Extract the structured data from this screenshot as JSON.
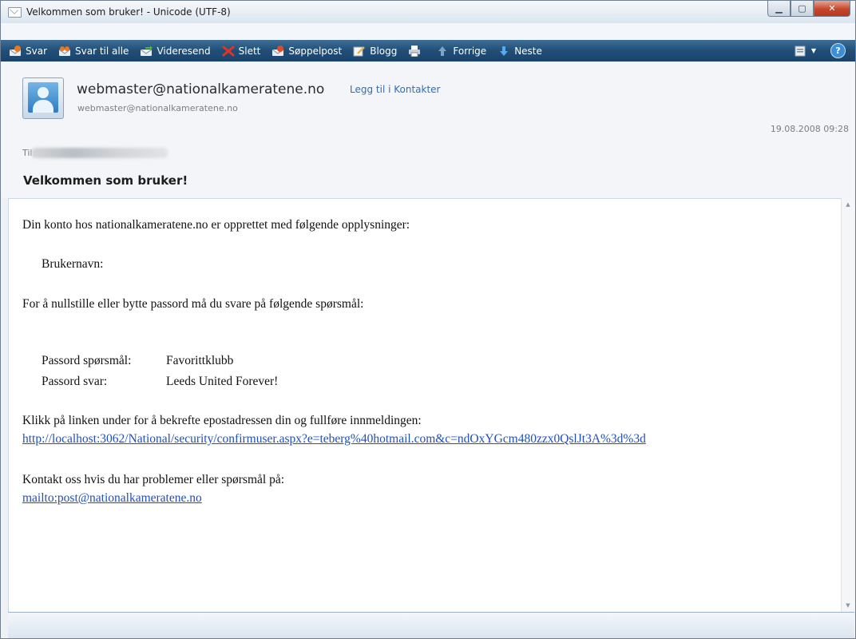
{
  "window": {
    "title": "Velkommen som bruker! - Unicode (UTF-8)"
  },
  "toolbar": {
    "items": [
      {
        "label": "Svar",
        "icon": "reply-icon"
      },
      {
        "label": "Svar til alle",
        "icon": "reply-all-icon"
      },
      {
        "label": "Videresend",
        "icon": "forward-icon"
      },
      {
        "label": "Slett",
        "icon": "delete-icon"
      },
      {
        "label": "Søppelpost",
        "icon": "junk-icon"
      },
      {
        "label": "Blogg",
        "icon": "blog-icon"
      },
      {
        "label": "",
        "icon": "print-icon"
      },
      {
        "label": "Forrige",
        "icon": "previous-arrow-icon"
      },
      {
        "label": "Neste",
        "icon": "next-arrow-icon"
      }
    ]
  },
  "header": {
    "from_name": "webmaster@nationalkameratene.no",
    "add_contact": "Legg til i Kontakter",
    "from_address": "webmaster@nationalkameratene.no",
    "date": "19.08.2008 09:28",
    "to_label": "Til:",
    "subject": "Velkommen som bruker!"
  },
  "body": {
    "intro": "Din konto hos nationalkameratene.no er opprettet med følgende opplysninger:",
    "username_label": "Brukernavn:",
    "reset_text": "For å nullstille eller bytte passord må du svare på følgende spørsmål:",
    "question_label": "Passord spørsmål:",
    "question_value": "Favorittklubb",
    "answer_label": "Passord svar:",
    "answer_value": "Leeds United Forever!",
    "confirm_text": "Klikk på linken under for å bekrefte epostadressen din og fullføre innmeldingen:",
    "confirm_link": "http://localhost:3062/National/security/confirmuser.aspx?e=teberg%40hotmail.com&c=ndOxYGcm480zzx0QslJt3A%3d%3d",
    "contact_text": "Kontakt oss hvis du har problemer eller spørsmål på:",
    "contact_link": "mailto:post@nationalkameratene.no"
  },
  "colors": {
    "toolbar": "#214e77",
    "link": "#1f4fbd",
    "close_button": "#c5462d"
  }
}
